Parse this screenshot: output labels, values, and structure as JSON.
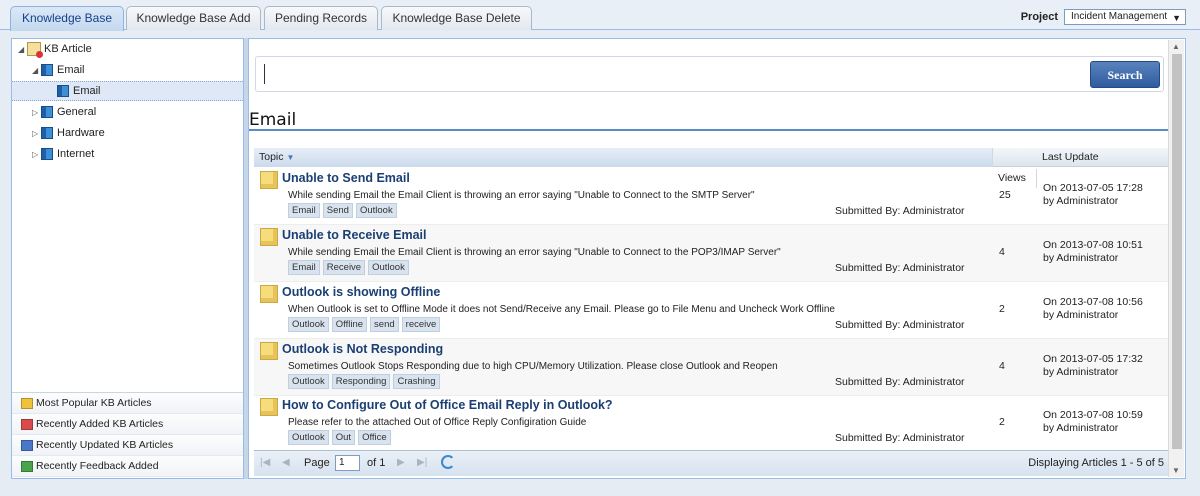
{
  "tabs": [
    {
      "label": "Knowledge Base",
      "active": true
    },
    {
      "label": "Knowledge Base Add",
      "active": false
    },
    {
      "label": "Pending Records",
      "active": false
    },
    {
      "label": "Knowledge Base Delete",
      "active": false
    }
  ],
  "project": {
    "label": "Project",
    "value": "Incident Management"
  },
  "tree": {
    "root": "KB Article",
    "email": "Email",
    "email_child": "Email",
    "general": "General",
    "hardware": "Hardware",
    "internet": "Internet"
  },
  "links": [
    {
      "label": "Most Popular KB Articles",
      "color": "#f0c23b"
    },
    {
      "label": "Recently Added KB Articles",
      "color": "#d94b4b"
    },
    {
      "label": "Recently Updated KB Articles",
      "color": "#4a78c9"
    },
    {
      "label": "Recently Feedback Added",
      "color": "#4aa24a"
    }
  ],
  "search": {
    "button": "Search",
    "value": ""
  },
  "page_title": "Email",
  "grid": {
    "headers": {
      "topic": "Topic",
      "views": "Views",
      "update": "Last Update"
    },
    "rows": [
      {
        "title": "Unable to Send Email",
        "desc": "While sending Email the Email Client is throwing an error saying \"Unable to Connect to the SMTP Server\"",
        "tags": [
          "Email",
          "Send",
          "Outlook"
        ],
        "submitted": "Submitted By: Administrator",
        "views": "25",
        "date": "On 2013-07-05 17:28",
        "by": "by Administrator"
      },
      {
        "title": "Unable to Receive Email",
        "desc": "While sending Email the Email Client is throwing an error saying \"Unable to Connect to the POP3/IMAP Server\"",
        "tags": [
          "Email",
          "Receive",
          "Outlook"
        ],
        "submitted": "Submitted By: Administrator",
        "views": "4",
        "date": "On 2013-07-08 10:51",
        "by": "by Administrator"
      },
      {
        "title": "Outlook is showing Offline",
        "desc": "When Outlook is set to Offline Mode it does not Send/Receive any Email. Please go to File Menu and Uncheck Work Offline",
        "tags": [
          "Outlook",
          "Offline",
          "send",
          "receive"
        ],
        "submitted": "Submitted By: Administrator",
        "views": "2",
        "date": "On 2013-07-08 10:56",
        "by": "by Administrator"
      },
      {
        "title": "Outlook is Not Responding",
        "desc": "Sometimes Outlook Stops Responding due to high CPU/Memory Utilization. Please close Outlook and Reopen",
        "tags": [
          "Outlook",
          "Responding",
          "Crashing"
        ],
        "submitted": "Submitted By: Administrator",
        "views": "4",
        "date": "On 2013-07-05 17:32",
        "by": "by Administrator"
      },
      {
        "title": "How to Configure Out of Office Email Reply in Outlook?",
        "desc": "Please refer to the attached Out of Office Reply Configiration Guide",
        "tags": [
          "Outlook",
          "Out",
          "Office"
        ],
        "submitted": "Submitted By: Administrator",
        "views": "2",
        "date": "On 2013-07-08 10:59",
        "by": "by Administrator"
      }
    ]
  },
  "pager": {
    "page_label": "Page",
    "page": "1",
    "of": "of 1",
    "display": "Displaying Articles 1 - 5 of 5"
  }
}
